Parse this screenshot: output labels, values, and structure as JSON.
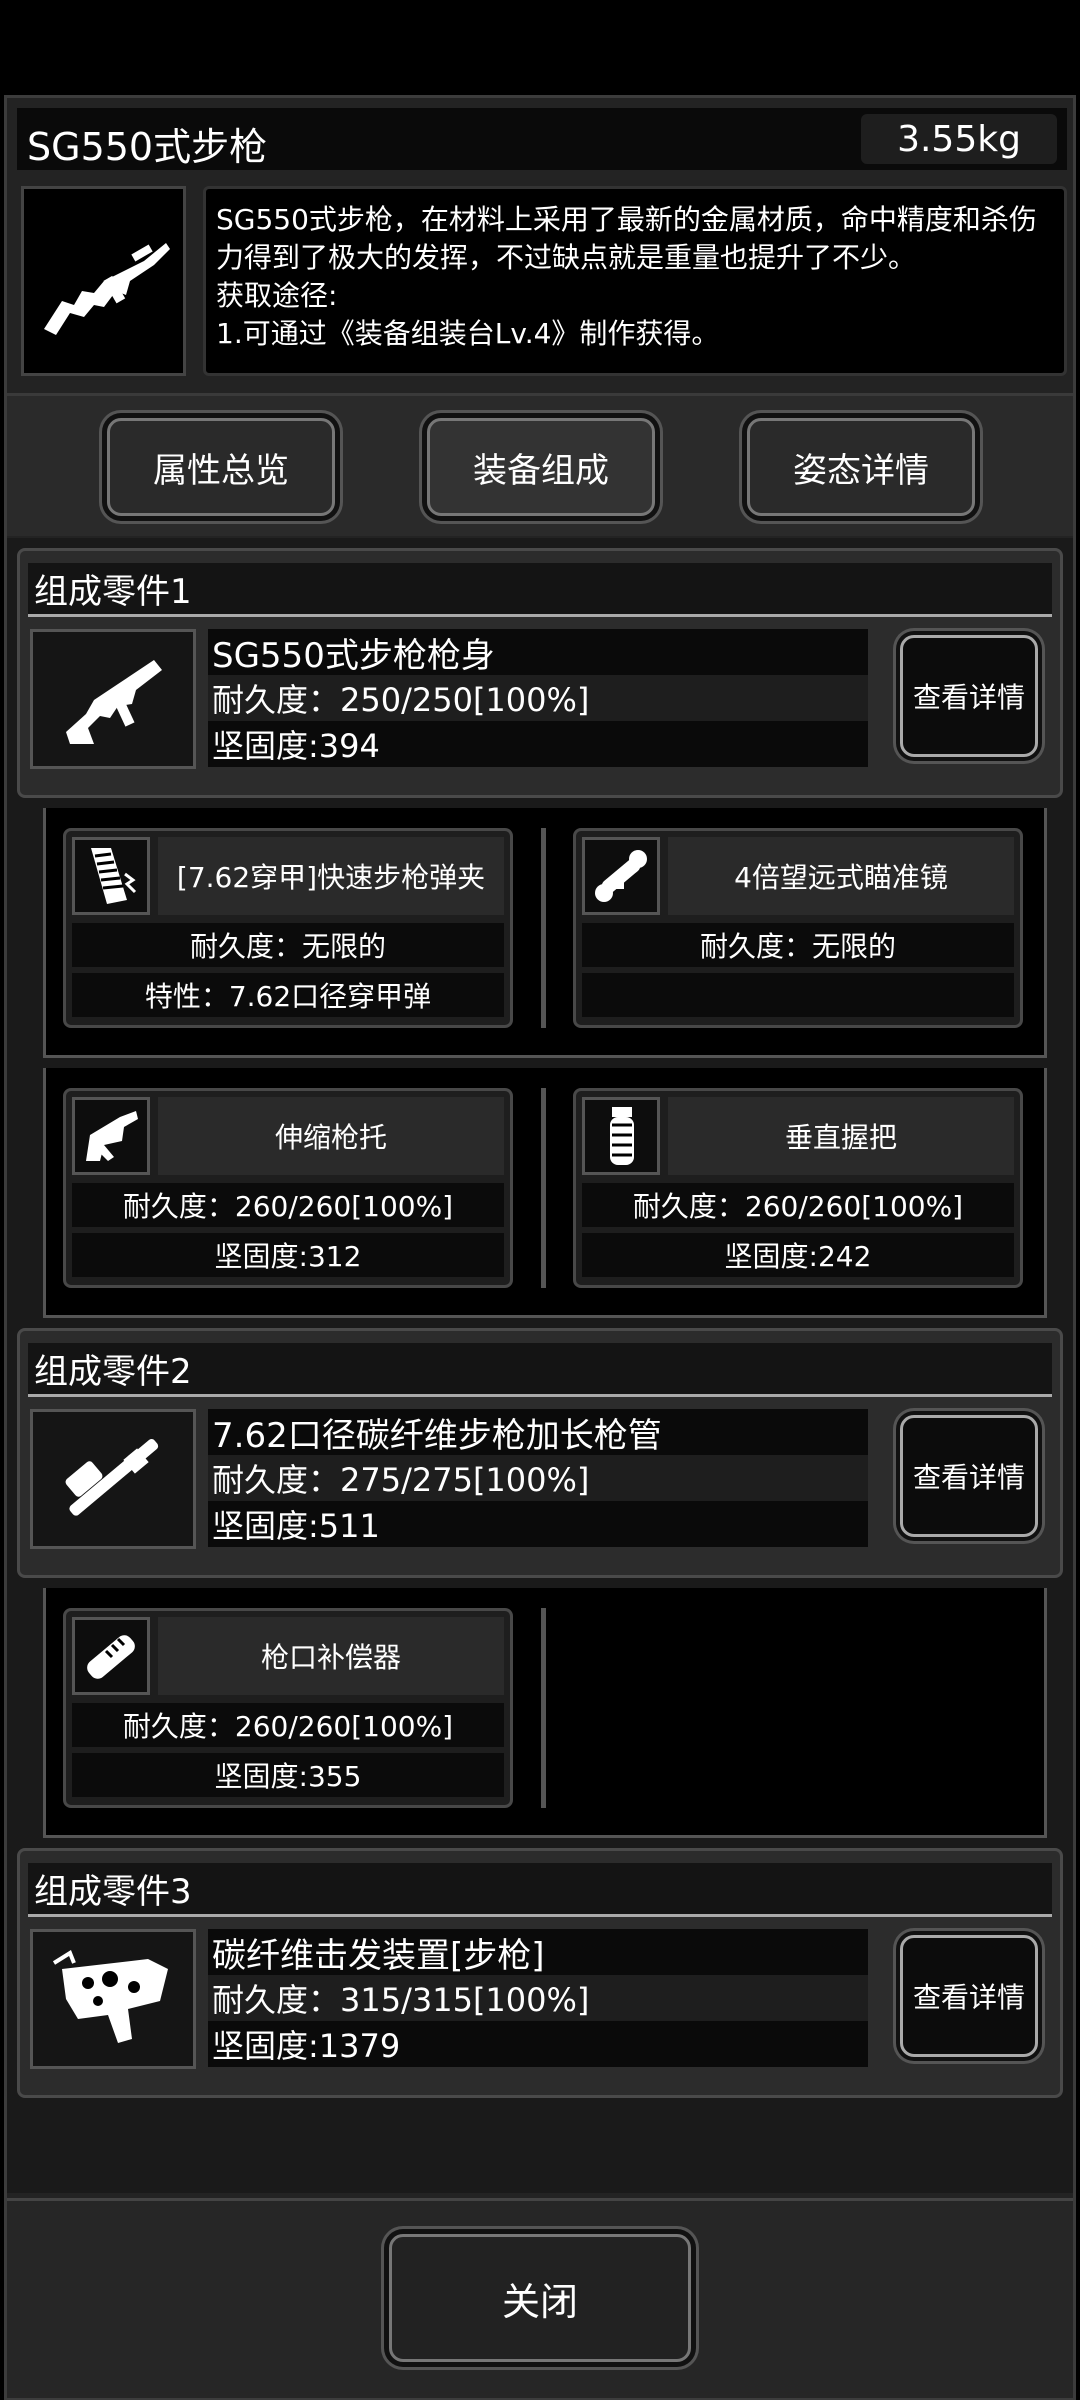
{
  "item": {
    "name": "SG550式步枪",
    "weight": "3.55kg",
    "description": "SG550式步枪，在材料上采用了最新的金属材质，命中精度和杀伤力得到了极大的发挥，不过缺点就是重量也提升了不少。",
    "acquire_title": "获取途径:",
    "acquire_line": "1.可通过《装备组装台Lv.4》制作获得。",
    "icon": "rifle-icon"
  },
  "tabs": [
    {
      "label": "属性总览"
    },
    {
      "label": "装备组成"
    },
    {
      "label": "姿态详情"
    }
  ],
  "parts": [
    {
      "header": "组成零件1",
      "name": "SG550式步枪枪身",
      "durability": "耐久度：250/250[100%]",
      "hardness": "坚固度:394",
      "detail_label": "查看详情",
      "icon": "rifle-body-icon",
      "attachments": [
        {
          "name": "[7.62穿甲]快速步枪弹夹",
          "line1": "耐久度：无限的",
          "line2": "特性：7.62口径穿甲弹",
          "icon": "magazine-icon"
        },
        {
          "name": "4倍望远式瞄准镜",
          "line1": "耐久度：无限的",
          "line2": "",
          "icon": "scope-icon"
        },
        {
          "name": "伸缩枪托",
          "line1": "耐久度：260/260[100%]",
          "line2": "坚固度:312",
          "icon": "stock-icon"
        },
        {
          "name": "垂直握把",
          "line1": "耐久度：260/260[100%]",
          "line2": "坚固度:242",
          "icon": "grip-icon"
        }
      ]
    },
    {
      "header": "组成零件2",
      "name": "7.62口径碳纤维步枪加长枪管",
      "durability": "耐久度：275/275[100%]",
      "hardness": "坚固度:511",
      "detail_label": "查看详情",
      "icon": "barrel-icon",
      "attachments": [
        {
          "name": "枪口补偿器",
          "line1": "耐久度：260/260[100%]",
          "line2": "坚固度:355",
          "icon": "compensator-icon"
        }
      ]
    },
    {
      "header": "组成零件3",
      "name": "碳纤维击发装置[步枪]",
      "durability": "耐久度：315/315[100%]",
      "hardness": "坚固度:1379",
      "detail_label": "查看详情",
      "icon": "trigger-icon"
    }
  ],
  "close_label": "关闭"
}
